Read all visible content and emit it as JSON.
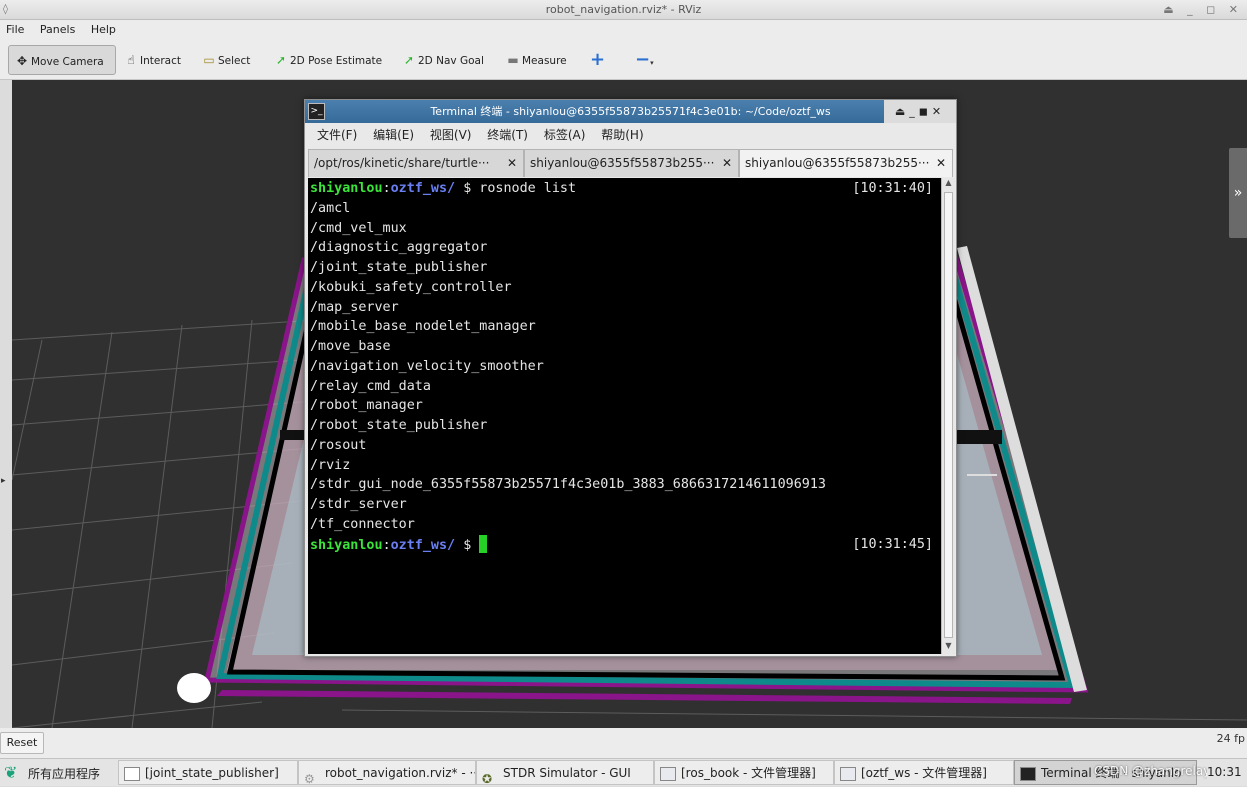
{
  "rviz": {
    "title": "robot_navigation.rviz* - RViz",
    "menu": [
      "File",
      "Panels",
      "Help"
    ],
    "tools": [
      {
        "label": "Move Camera",
        "icon": "move-camera-icon",
        "glyph": "✥"
      },
      {
        "label": "Interact",
        "icon": "hand-icon",
        "glyph": "☝"
      },
      {
        "label": "Select",
        "icon": "select-box-icon",
        "glyph": "▭"
      },
      {
        "label": "2D Pose Estimate",
        "icon": "green-arrow-icon",
        "glyph": "➚"
      },
      {
        "label": "2D Nav Goal",
        "icon": "green-arrow-icon",
        "glyph": "➚"
      },
      {
        "label": "Measure",
        "icon": "ruler-icon",
        "glyph": "▬"
      }
    ],
    "add_tool_glyph": "+",
    "remove_tool_glyph": "−",
    "reset_label": "Reset",
    "fps": "24 fp",
    "colors": {
      "viewport_bg": "#303030",
      "grid": "#5a5a5a",
      "map_border_teal": "#0f8a8a",
      "map_border_purple": "#8a148a"
    }
  },
  "terminal": {
    "title": "Terminal 终端 - shiyanlou@6355f55873b25571f4c3e01b: ~/Code/oztf_ws",
    "menu": [
      "文件(F)",
      "编辑(E)",
      "视图(V)",
      "终端(T)",
      "标签(A)",
      "帮助(H)"
    ],
    "tabs": [
      {
        "label": "/opt/ros/kinetic/share/turtle···"
      },
      {
        "label": "shiyanlou@6355f55873b255···"
      },
      {
        "label": "shiyanlou@6355f55873b255···"
      }
    ],
    "prompt_user": "shiyanlou",
    "prompt_dir": "oztf_ws/",
    "command": "$ rosnode list",
    "time_start": "[10:31:40]",
    "time_end": "[10:31:45]",
    "nodes": [
      "/amcl",
      "/cmd_vel_mux",
      "/diagnostic_aggregator",
      "/joint_state_publisher",
      "/kobuki_safety_controller",
      "/map_server",
      "/mobile_base_nodelet_manager",
      "/move_base",
      "/navigation_velocity_smoother",
      "/relay_cmd_data",
      "/robot_manager",
      "/robot_state_publisher",
      "/rosout",
      "/rviz",
      "/stdr_gui_node_6355f55873b25571f4c3e01b_3883_6866317214611096913",
      "/stdr_server",
      "/tf_connector"
    ],
    "second_prompt": "$"
  },
  "taskbar": {
    "start": "所有应用程序",
    "tasks": [
      {
        "label": "[joint_state_publisher]"
      },
      {
        "label": "robot_navigation.rviz* - ···"
      },
      {
        "label": "STDR Simulator - GUI"
      },
      {
        "label": "[ros_book - 文件管理器]"
      },
      {
        "label": "[oztf_ws - 文件管理器]"
      },
      {
        "label": "Terminal 终端 - shiyanlo"
      }
    ],
    "watermark": "CSDN @zhangrelay",
    "clock": "10:31"
  }
}
